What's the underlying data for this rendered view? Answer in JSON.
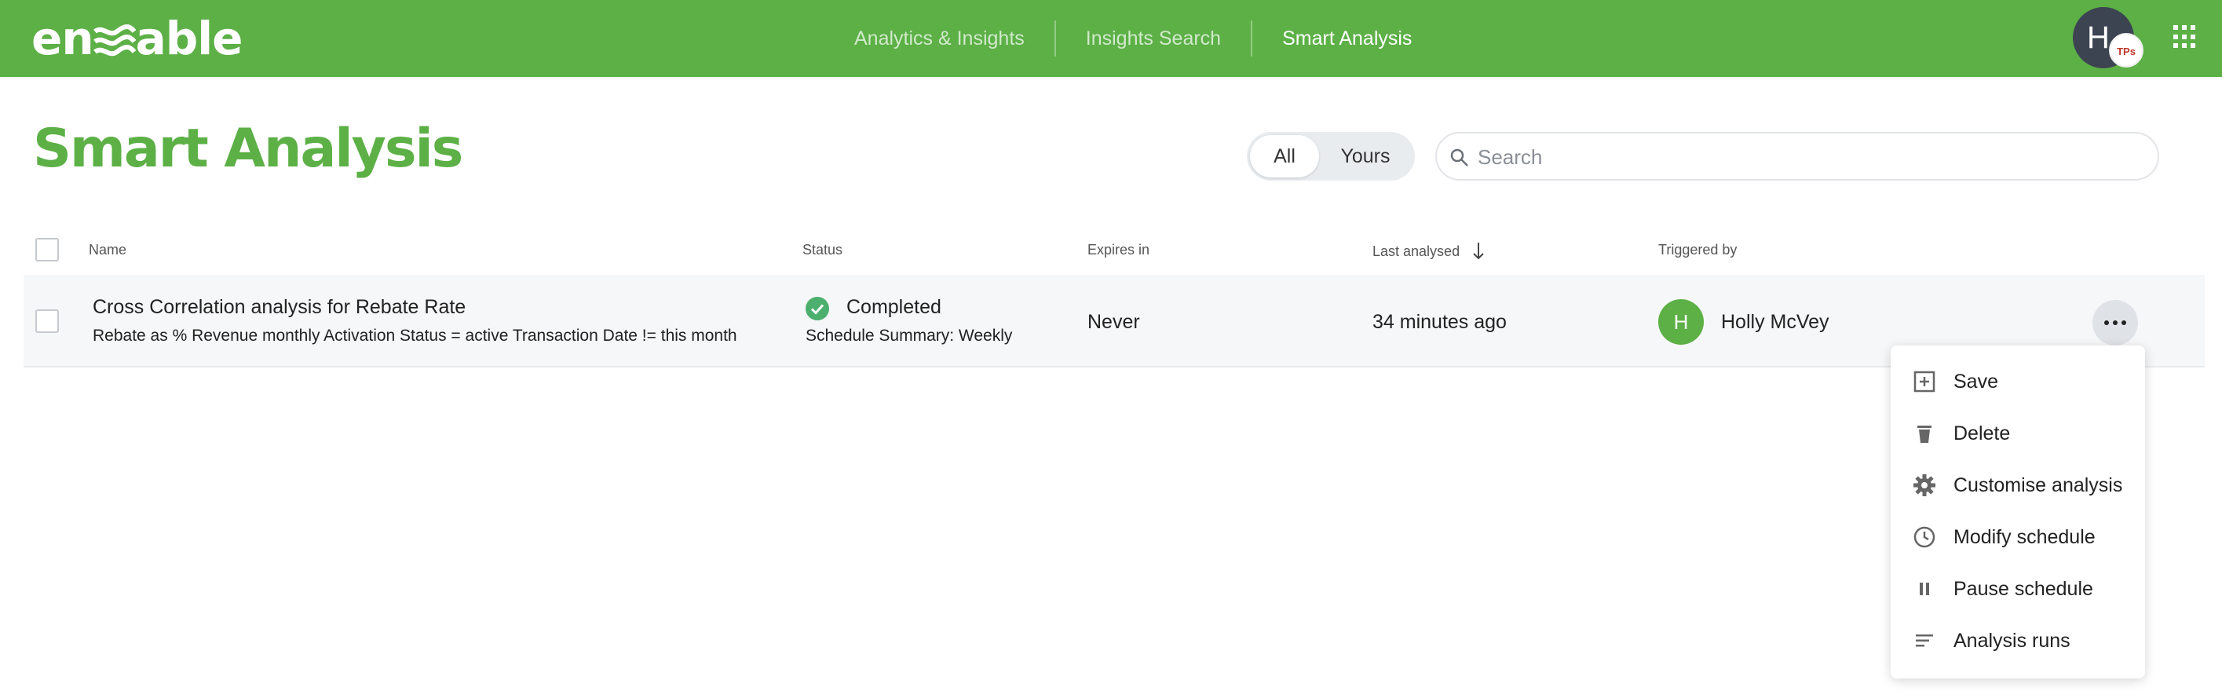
{
  "brand": {
    "logo_text_left": "en",
    "logo_text_right": "able"
  },
  "nav": {
    "items": [
      {
        "label": "Analytics & Insights"
      },
      {
        "label": "Insights Search"
      },
      {
        "label": "Smart Analysis"
      }
    ]
  },
  "user": {
    "initial": "H",
    "badge": "TPs"
  },
  "page": {
    "title": "Smart Analysis"
  },
  "filter": {
    "all_label": "All",
    "yours_label": "Yours",
    "selected": "All"
  },
  "search": {
    "placeholder": "Search",
    "value": ""
  },
  "table": {
    "columns": {
      "name": "Name",
      "status": "Status",
      "expires": "Expires in",
      "last_analysed": "Last analysed",
      "triggered_by": "Triggered by"
    },
    "rows": [
      {
        "name": "Cross Correlation analysis for Rebate Rate",
        "description": "Rebate as % Revenue monthly Activation Status = active Transaction Date != this month",
        "status": "Completed",
        "schedule": "Schedule Summary: Weekly",
        "expires": "Never",
        "last_analysed": "34 minutes ago",
        "triggered_initial": "H",
        "triggered_by": "Holly McVey"
      }
    ]
  },
  "menu": {
    "items": [
      {
        "label": "Save",
        "icon": "add-box-icon"
      },
      {
        "label": "Delete",
        "icon": "trash-icon"
      },
      {
        "label": "Customise analysis",
        "icon": "gear-icon"
      },
      {
        "label": "Modify schedule",
        "icon": "clock-icon"
      },
      {
        "label": "Pause schedule",
        "icon": "pause-icon"
      },
      {
        "label": "Analysis runs",
        "icon": "lines-icon"
      }
    ]
  },
  "colors": {
    "brand_green": "#5cb046",
    "status_green": "#4caf6e"
  }
}
